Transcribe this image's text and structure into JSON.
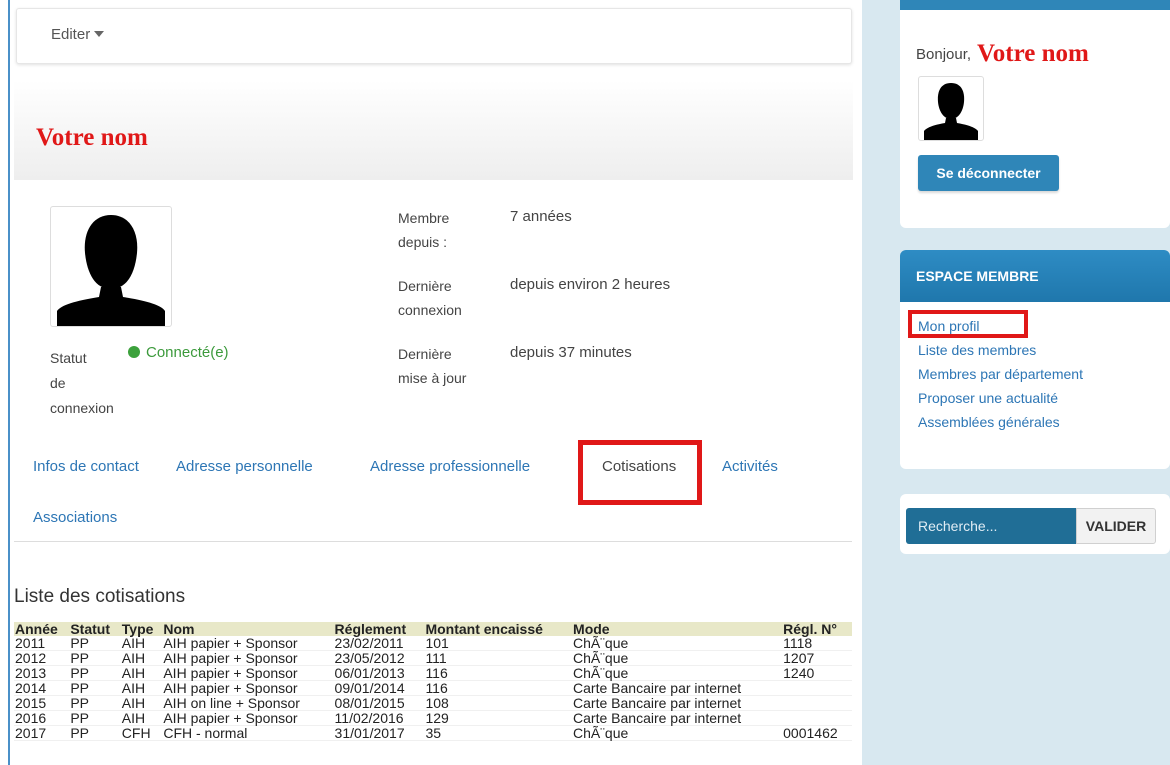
{
  "toolbar": {
    "edit_label": "Editer"
  },
  "profile": {
    "name": "Votre nom",
    "status_label": [
      "Statut",
      "de",
      "connexion"
    ],
    "status_value": "Connecté(e)",
    "status_color": "#3ca13c",
    "info": [
      {
        "label": [
          "Membre",
          "depuis :"
        ],
        "value": "7 années"
      },
      {
        "label": [
          "Dernière",
          "connexion"
        ],
        "value": "depuis environ 2 heures"
      },
      {
        "label": [
          "Dernière",
          "mise à jour"
        ],
        "value": "depuis 37 minutes"
      }
    ]
  },
  "tabs": [
    {
      "label": "Infos de contact"
    },
    {
      "label": "Adresse personnelle"
    },
    {
      "label": "Adresse professionnelle"
    },
    {
      "label": "Cotisations",
      "active": true
    },
    {
      "label": "Activités"
    },
    {
      "label": "Associations"
    }
  ],
  "cotisations": {
    "title": "Liste des cotisations",
    "columns": [
      "Année",
      "Statut",
      "Type",
      "Nom",
      "Réglement",
      "Montant encaissé",
      "Mode",
      "Régl. N°"
    ],
    "rows": [
      [
        "2011",
        "PP",
        "AIH",
        "AIH papier + Sponsor",
        "23/02/2011",
        "101",
        "ChÃ¨que",
        "1118"
      ],
      [
        "2012",
        "PP",
        "AIH",
        "AIH papier + Sponsor",
        "23/05/2012",
        "111",
        "ChÃ¨que",
        "1207"
      ],
      [
        "2013",
        "PP",
        "AIH",
        "AIH papier + Sponsor",
        "06/01/2013",
        "116",
        "ChÃ¨que",
        "1240"
      ],
      [
        "2014",
        "PP",
        "AIH",
        "AIH papier + Sponsor",
        "09/01/2014",
        "116",
        "Carte Bancaire par internet",
        ""
      ],
      [
        "2015",
        "PP",
        "AIH",
        "AIH on line + Sponsor",
        "08/01/2015",
        "108",
        "Carte Bancaire par internet",
        ""
      ],
      [
        "2016",
        "PP",
        "AIH",
        "AIH papier + Sponsor",
        "11/02/2016",
        "129",
        "Carte Bancaire par internet",
        ""
      ],
      [
        "2017",
        "PP",
        "CFH",
        "CFH - normal",
        "31/01/2017",
        "35",
        "ChÃ¨que",
        "0001462"
      ]
    ]
  },
  "sidebar": {
    "greeting": "Bonjour,",
    "user_name": "Votre nom",
    "logout_label": "Se déconnecter",
    "member_space": {
      "title": "ESPACE MEMBRE",
      "links": [
        "Mon profil",
        "Liste des membres",
        "Membres par département",
        "Proposer une actualité",
        "Assemblées générales"
      ]
    },
    "search": {
      "placeholder": "Recherche...",
      "button_label": "VALIDER"
    }
  },
  "colors": {
    "accent": "#2f86b8",
    "highlight": "#e01818",
    "link": "#2d76b5"
  }
}
